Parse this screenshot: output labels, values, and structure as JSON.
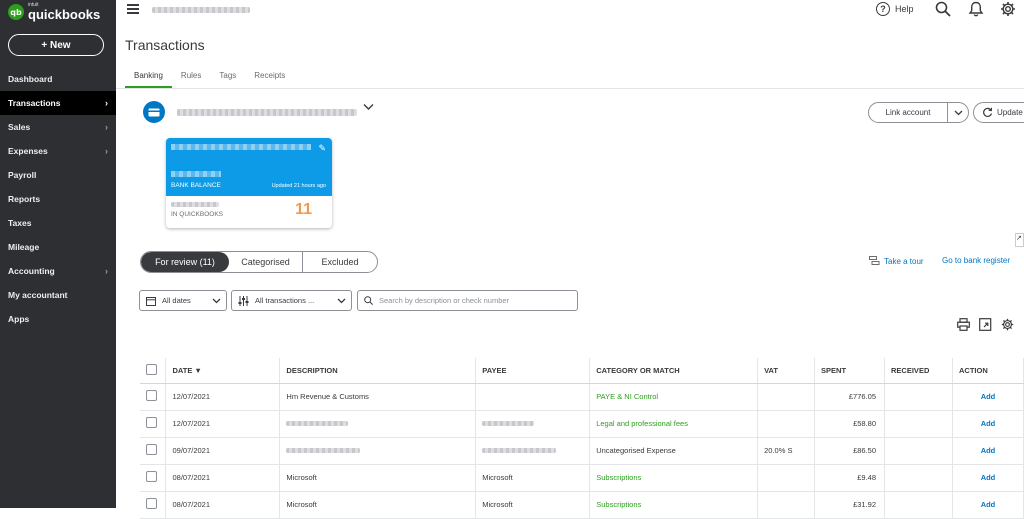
{
  "brand": {
    "mark": "qb",
    "small": "intuit",
    "name": "quickbooks"
  },
  "sidebar": {
    "new_label": "+ New",
    "items": [
      {
        "label": "Dashboard",
        "chevron": ""
      },
      {
        "label": "Transactions",
        "chevron": "›"
      },
      {
        "label": "Sales",
        "chevron": "›"
      },
      {
        "label": "Expenses",
        "chevron": "›"
      },
      {
        "label": "Payroll",
        "chevron": ""
      },
      {
        "label": "Reports",
        "chevron": ""
      },
      {
        "label": "Taxes",
        "chevron": ""
      },
      {
        "label": "Mileage",
        "chevron": ""
      },
      {
        "label": "Accounting",
        "chevron": "›"
      },
      {
        "label": "My accountant",
        "chevron": ""
      },
      {
        "label": "Apps",
        "chevron": ""
      }
    ]
  },
  "header": {
    "help_label": "Help",
    "help_glyph": "?"
  },
  "page": {
    "title": "Transactions"
  },
  "tabs": [
    "Banking",
    "Rules",
    "Tags",
    "Receipts"
  ],
  "account": {
    "link_label": "Link account",
    "update_label": "Update",
    "card": {
      "bank_balance_label": "BANK BALANCE",
      "updated_label": "Updated 21 hours ago",
      "in_qb_label": "IN QUICKBOOKS",
      "count": "11"
    }
  },
  "review_tabs": [
    "For review (11)",
    "Categorised",
    "Excluded"
  ],
  "links": {
    "tour": "Take a tour",
    "register": "Go to bank register"
  },
  "filters": {
    "dates": "All dates",
    "transactions": "All transactions ...",
    "search_placeholder": "Search by description or check number"
  },
  "table": {
    "columns": [
      "DATE ▼",
      "DESCRIPTION",
      "PAYEE",
      "CATEGORY OR MATCH",
      "VAT",
      "SPENT",
      "RECEIVED",
      "ACTION"
    ],
    "rows": [
      {
        "date": "12/07/2021",
        "description": "Hm Revenue & Customs",
        "payee": "",
        "category": "PAYE & NI Control",
        "vat": "",
        "spent": "£776.05",
        "received": "",
        "action": "Add"
      },
      {
        "date": "12/07/2021",
        "description": "",
        "payee": "",
        "category": "Legal and professional fees",
        "vat": "",
        "spent": "£58.80",
        "received": "",
        "action": "Add"
      },
      {
        "date": "09/07/2021",
        "description": "",
        "payee": "",
        "category": "Uncategorised Expense",
        "vat": "20.0% S",
        "spent": "£86.50",
        "received": "",
        "action": "Add"
      },
      {
        "date": "08/07/2021",
        "description": "Microsoft",
        "payee": "Microsoft",
        "category": "Subscriptions",
        "vat": "",
        "spent": "£9.48",
        "received": "",
        "action": "Add"
      },
      {
        "date": "08/07/2021",
        "description": "Microsoft",
        "payee": "Microsoft",
        "category": "Subscriptions",
        "vat": "",
        "spent": "£31.92",
        "received": "",
        "action": "Add"
      }
    ]
  },
  "colors": {
    "sidebar": "#2e2f33",
    "accent_green": "#2ca01c",
    "link_blue": "#0077c5",
    "card_blue": "#0d9be8",
    "count_orange": "#f2994a"
  }
}
